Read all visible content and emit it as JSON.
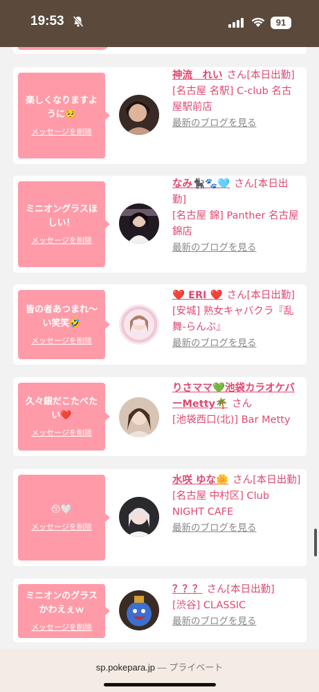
{
  "status_bar": {
    "time": "19:53",
    "battery": "91",
    "icons": [
      "bell-slash-icon",
      "signal-icon",
      "wifi-icon",
      "battery-icon"
    ]
  },
  "colors": {
    "accent": "#e04870",
    "bubble": "#ff9ba8",
    "status_bar": "#5b4a3c"
  },
  "cards": [
    {
      "message": "楽しくなりますように🥺",
      "delete_label": "メッセージを削除",
      "name": "神流　れい",
      "san": "さん[本日出勤]",
      "shop": "[名古屋 名駅] C-club 名古屋駅前店",
      "blog": "最新のブログを見る"
    },
    {
      "message": "ミニオングラスほしい！",
      "delete_label": "メッセージを削除",
      "name": "なみ🐈‍⬛🐾🩵",
      "san": "さん[本日出勤]",
      "shop": "[名古屋 錦] Panther 名古屋錦店",
      "blog": "最新のブログを見る"
    },
    {
      "message": "皆の者あつまれ〜い笑笑🤣",
      "delete_label": "メッセージを削除",
      "name": "❤️ ERI ❤️",
      "san": "さん[本日出勤]",
      "shop": "[安城] 熟女キャバクラ『乱舞-らんぶ』",
      "blog": "最新のブログを見る"
    },
    {
      "message": "久々銀だこたべたい❤️",
      "delete_label": "メッセージを削除",
      "name": "りさママ💚池袋カラオケバーMetty🌴",
      "san": "さん",
      "shop": "[池袋西口(北)] Bar Metty",
      "blog": ""
    },
    {
      "message": "😚🤍",
      "delete_label": "メッセージを削除",
      "name": "水咲 ゆな🌼",
      "san": "さん[本日出勤]",
      "shop": "[名古屋 中村区] Club NIGHT CAFE",
      "blog": "最新のブログを見る"
    },
    {
      "message": "ミニオンのグラスかわえぇｗ",
      "delete_label": "メッセージを削除",
      "name": "？？？",
      "san": "さん[本日出勤]",
      "shop": "[渋谷] CLASSIC",
      "blog": "最新のブログを見る"
    }
  ],
  "browser": {
    "domain": "sp.pokepara.jp",
    "mode": "— プライベート"
  }
}
